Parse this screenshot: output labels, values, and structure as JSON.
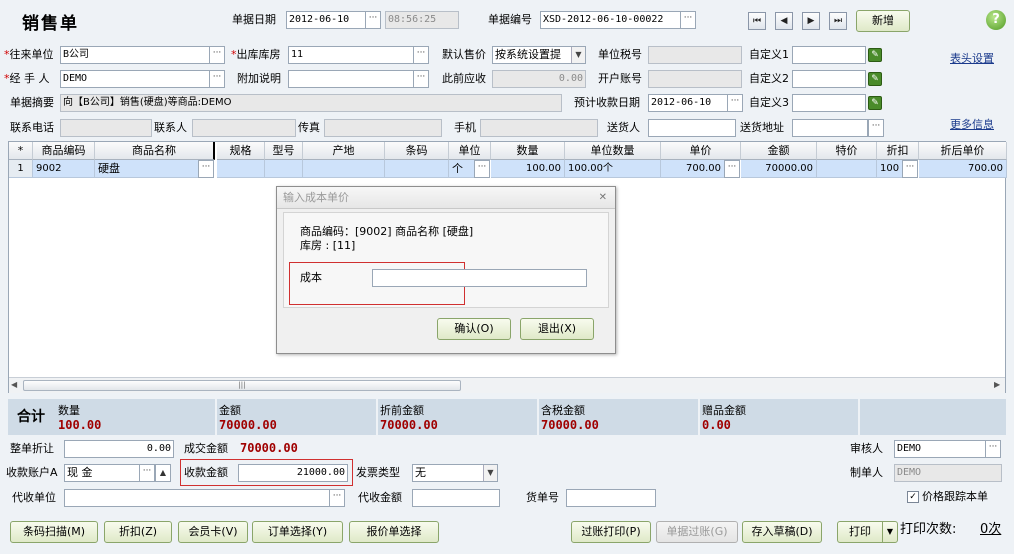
{
  "header": {
    "title": "销售单",
    "date_label": "单据日期",
    "date_value": "2012-06-10",
    "time_value": "08:56:25",
    "number_label": "单据编号",
    "number_value": "XSD-2012-06-10-00022",
    "nav_first": "⏮",
    "nav_prev": "◀",
    "nav_next": "▶",
    "nav_last": "⏭",
    "add_button": "新增",
    "help_icon": "?"
  },
  "form": {
    "partner_label": "往来单位",
    "partner_value": "B公司",
    "warehouse_label": "出库库房",
    "warehouse_value": "11",
    "default_price_label": "默认售价",
    "default_price_value": "按系统设置提",
    "tax_no_label": "单位税号",
    "custom1_label": "自定义1",
    "header_settings": "表头设置",
    "handler_label": "经 手 人",
    "handler_value": "DEMO",
    "note_label": "附加说明",
    "receivable_label": "此前应收",
    "receivable_value": "0.00",
    "bank_label": "开户账号",
    "custom2_label": "自定义2",
    "summary_label": "单据摘要",
    "summary_value": "向【B公司】销售(硬盘)等商品:DEMO",
    "due_date_label": "预计收款日期",
    "due_date_value": "2012-06-10",
    "custom3_label": "自定义3",
    "phone_label": "联系电话",
    "contact_label": "联系人",
    "fax_label": "传真",
    "mobile_label": "手机",
    "deliverer_label": "送货人",
    "address_label": "送货地址",
    "more_info": "更多信息",
    "required_mark": "*"
  },
  "grid": {
    "columns": [
      "*",
      "商品编码",
      "商品名称",
      "规格",
      "型号",
      "产地",
      "条码",
      "单位",
      "数量",
      "单位数量",
      "单价",
      "金额",
      "特价",
      "折扣",
      "折后单价"
    ],
    "row": {
      "index": "1",
      "code": "9002",
      "name": "硬盘",
      "unit": "个",
      "qty": "100.00",
      "unit_qty": "100.00个",
      "price": "700.00",
      "amount": "70000.00",
      "discount": "100",
      "discounted_price": "700.00"
    },
    "scroll_left": "◀",
    "scroll_right": "▶",
    "scroll_grip": "|||"
  },
  "dialog": {
    "title": "输入成本单价",
    "line1": "商品编码：[9002] 商品名称 [硬盘]",
    "line2": "库房 : [11]",
    "cost_label": "成本",
    "cost_value": "",
    "ok_button": "确认(O)",
    "exit_button": "退出(X)",
    "close": "✕"
  },
  "totals": {
    "label": "合计",
    "qty_label": "数量",
    "qty_value": "100.00",
    "amount_label": "金额",
    "amount_value": "70000.00",
    "pre_discount_label": "折前金额",
    "pre_discount_value": "70000.00",
    "tax_incl_label": "含税金额",
    "tax_incl_value": "70000.00",
    "gift_label": "赠品金额",
    "gift_value": "0.00"
  },
  "footer": {
    "bill_discount_label": "整单折让",
    "bill_discount_value": "0.00",
    "deal_amount_label": "成交金额",
    "deal_amount_value": "70000.00",
    "auditor_label": "审核人",
    "auditor_value": "DEMO",
    "account_label": "收款账户A",
    "account_value": "现    金",
    "received_label": "收款金额",
    "received_value": "21000.00",
    "invoice_label": "发票类型",
    "invoice_value": "无",
    "maker_label": "制单人",
    "maker_value": "DEMO",
    "collect_unit_label": "代收单位",
    "collect_amount_label": "代收金额",
    "waybill_label": "货单号",
    "track_price_label": "价格跟踪本单",
    "track_price_checked": "✓"
  },
  "toolbar": {
    "barcode": "条码扫描(M)",
    "discount": "折扣(Z)",
    "member_card": "会员卡(V)",
    "order_select": "订单选择(Y)",
    "quote_select": "报价单选择",
    "post_print": "过账打印(P)",
    "post": "单据过账(G)",
    "save_draft": "存入草稿(D)",
    "print": "打印",
    "print_arrow": "▼",
    "print_count_label": "打印次数:",
    "print_count_value": "0次"
  }
}
